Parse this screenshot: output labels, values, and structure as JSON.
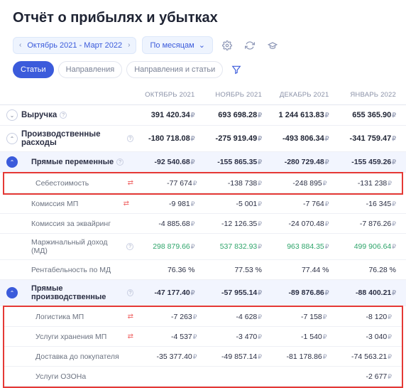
{
  "title": "Отчёт о прибылях и убытках",
  "toolbar": {
    "range": "Октябрь 2021 - Март 2022",
    "granularity": "По месяцам"
  },
  "tabs": [
    "Статьи",
    "Направления",
    "Направления и статьи"
  ],
  "columns": [
    "ОКТЯБРЬ 2021",
    "НОЯБРЬ 2021",
    "ДЕКАБРЬ 2021",
    "ЯНВАРЬ 2022"
  ],
  "rows": {
    "revenue": {
      "label": "Выручка",
      "vals": [
        "391 420.34",
        "693 698.28",
        "1 244 613.83",
        "655 365.90"
      ]
    },
    "prodExp": {
      "label": "Производственные расходы",
      "vals": [
        "-180 718.08",
        "-275 919.49",
        "-493 806.34",
        "-341 759.47"
      ]
    },
    "directVar": {
      "label": "Прямые переменные",
      "vals": [
        "-92 540.68",
        "-155 865.35",
        "-280 729.48",
        "-155 459.26"
      ]
    },
    "cogs": {
      "label": "Себестоимость",
      "vals": [
        "-77 674",
        "-138 738",
        "-248 895",
        "-131 238"
      ]
    },
    "mpComm": {
      "label": "Комиссия МП",
      "vals": [
        "-9 981",
        "-5 001",
        "-7 764",
        "-16 345"
      ]
    },
    "acq": {
      "label": "Комиссия за эквайринг",
      "vals": [
        "-4 885.68",
        "-12 126.35",
        "-24 070.48",
        "-7 876.26"
      ]
    },
    "margin": {
      "label": "Маржинальный доход (МД)",
      "vals": [
        "298 879.66",
        "537 832.93",
        "963 884.35",
        "499 906.64"
      ]
    },
    "rent": {
      "label": "Рентабельность по МД",
      "vals": [
        "76.36 %",
        "77.53 %",
        "77.44 %",
        "76.28 %"
      ]
    },
    "directProd": {
      "label": "Прямые производственные",
      "vals": [
        "-47 177.40",
        "-57 955.14",
        "-89 876.86",
        "-88 400.21"
      ]
    },
    "log": {
      "label": "Логистика МП",
      "vals": [
        "-7 263",
        "-4 628",
        "-7 158",
        "-8 120"
      ]
    },
    "stor": {
      "label": "Услуги хранения МП",
      "vals": [
        "-4 537",
        "-3 470",
        "-1 540",
        "-3 040"
      ]
    },
    "deliv": {
      "label": "Доставка до покупателя",
      "vals": [
        "-35 377.40",
        "-49 857.14",
        "-81 178.86",
        "-74 563.21"
      ]
    },
    "ozon": {
      "label": "Услуги ОЗОНа",
      "vals": [
        "",
        "",
        "",
        "-2 677"
      ]
    }
  }
}
